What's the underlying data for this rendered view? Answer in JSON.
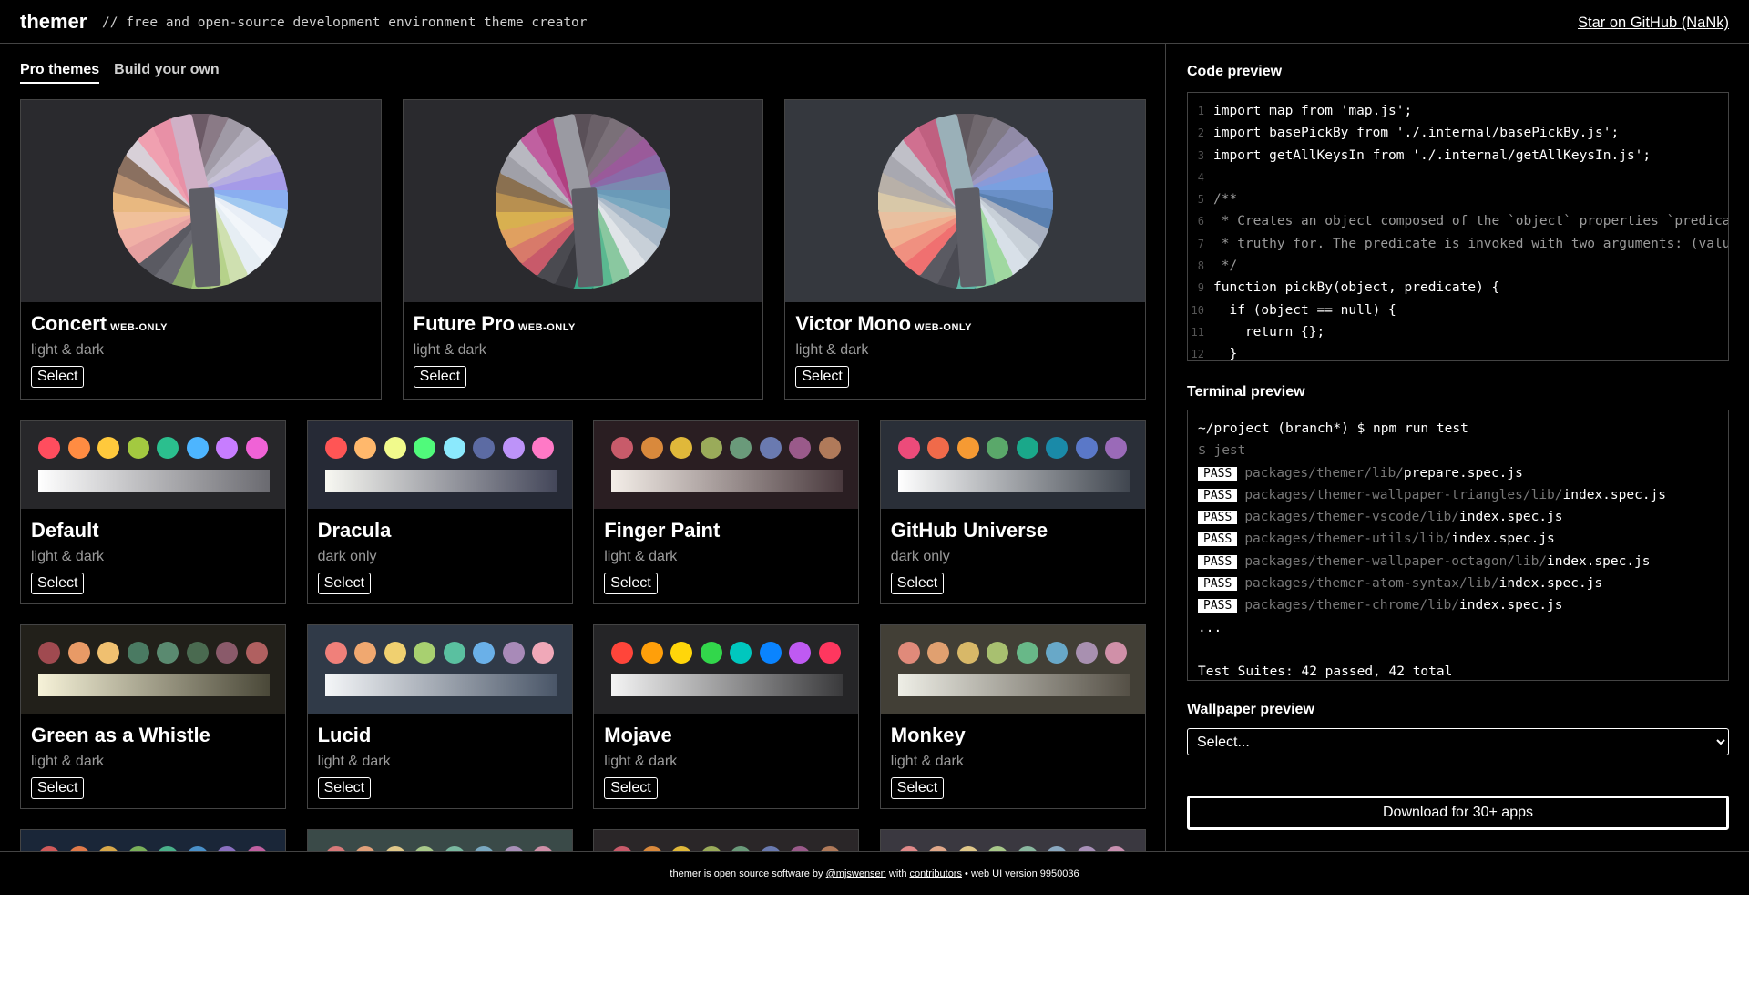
{
  "header": {
    "brand": "themer",
    "tagline": "// free and open-source development environment theme creator",
    "github_link": "Star on GitHub (NaNk)"
  },
  "tabs": [
    {
      "label": "Pro themes",
      "active": true
    },
    {
      "label": "Build your own",
      "active": false
    }
  ],
  "pro_themes": [
    {
      "name": "Concert",
      "badge": "WEB-ONLY",
      "modes": "light & dark",
      "select": "Select",
      "bg": "#2a2a2e",
      "fan": [
        "#6c5a66",
        "#8a7a86",
        "#a09aa6",
        "#b8b4c2",
        "#c7c2d6",
        "#b6aee0",
        "#a59ae8",
        "#8aaef0",
        "#a0c8f0",
        "#e8eef6",
        "#f2f6fa",
        "#e6eef4",
        "#cfe0b0",
        "#b6d28a",
        "#a0c878",
        "#8aa86a",
        "#6a6a72",
        "#5a5a62",
        "#e6a0a0",
        "#f0b0a6",
        "#f0c09a",
        "#e8b880",
        "#b89070",
        "#8a7060",
        "#d8d0d8",
        "#f0a0b0",
        "#e890a6",
        "#d0b0c6"
      ]
    },
    {
      "name": "Future Pro",
      "badge": "WEB-ONLY",
      "modes": "light & dark",
      "select": "Select",
      "bg": "#2a2a2e",
      "fan": [
        "#5a5058",
        "#6a6068",
        "#7a7078",
        "#8a6a8a",
        "#9a5a9a",
        "#8a6aa8",
        "#7a8ab0",
        "#6a9ab8",
        "#7aa8c0",
        "#a8b8c8",
        "#c8d0d8",
        "#e0e4e8",
        "#8ac8a0",
        "#5ab890",
        "#3aa888",
        "#3a3a40",
        "#4a4a50",
        "#c85a6a",
        "#d87a6a",
        "#e0a060",
        "#d8b050",
        "#b89050",
        "#8a7050",
        "#a0a0a8",
        "#b8b8c0",
        "#c060a0",
        "#b04080",
        "#9a9aa2"
      ]
    },
    {
      "name": "Victor Mono",
      "badge": "WEB-ONLY",
      "modes": "light & dark",
      "select": "Select",
      "bg": "#35383e",
      "fan": [
        "#60585e",
        "#70686e",
        "#807a86",
        "#908aa6",
        "#a09ac0",
        "#8a9ad8",
        "#7aa0e0",
        "#6a90c8",
        "#5a80b0",
        "#a8b0c0",
        "#c8d0d8",
        "#d8e0e8",
        "#a0d8a0",
        "#80c8a0",
        "#60b8a8",
        "#4a4a52",
        "#5a5a62",
        "#f07070",
        "#f09080",
        "#f0b090",
        "#e8c0a0",
        "#d8c8a8",
        "#b8b0a8",
        "#a8a8b0",
        "#c0c0c8",
        "#d07090",
        "#c06080",
        "#9ab0b8"
      ]
    }
  ],
  "themes": [
    {
      "name": "Default",
      "modes": "light & dark",
      "select": "Select",
      "bg": "#27272a",
      "dots": [
        "#ff4d5e",
        "#ff8c42",
        "#ffc93c",
        "#a3c940",
        "#2bbf8e",
        "#4db5ff",
        "#c77dff",
        "#f062d6"
      ],
      "grad": [
        "#ffffff",
        "#6a6a70"
      ]
    },
    {
      "name": "Dracula",
      "modes": "dark only",
      "select": "Select",
      "bg": "#262a36",
      "dots": [
        "#ff5555",
        "#ffb86c",
        "#f1fa8c",
        "#50fa7b",
        "#8be9fd",
        "#5c6ba3",
        "#bd93f9",
        "#ff79c6"
      ],
      "grad": [
        "#f8f8f2",
        "#44475a"
      ]
    },
    {
      "name": "Finger Paint",
      "modes": "light & dark",
      "select": "Select",
      "bg": "#2a1e22",
      "dots": [
        "#c85b6a",
        "#d9893c",
        "#e0b83a",
        "#9aab5a",
        "#6a9a7a",
        "#6a7ab0",
        "#9a5a8a",
        "#b07a5a"
      ],
      "grad": [
        "#f4eee8",
        "#4a3a3e"
      ]
    },
    {
      "name": "GitHub Universe",
      "modes": "dark only",
      "select": "Select",
      "bg": "#2a2f38",
      "dots": [
        "#ec4b7a",
        "#f06a4a",
        "#f59a33",
        "#5aa86a",
        "#1aa88a",
        "#1a8aa8",
        "#5a78c8",
        "#9a6ab8"
      ],
      "grad": [
        "#ffffff",
        "#40464f"
      ]
    },
    {
      "name": "Green as a Whistle",
      "modes": "light & dark",
      "select": "Select",
      "bg": "#22201a",
      "dots": [
        "#a04a50",
        "#e89a66",
        "#f0c070",
        "#4a7a62",
        "#5a8a70",
        "#4a6a50",
        "#8a5a6a",
        "#b06060"
      ],
      "grad": [
        "#f6f2d8",
        "#4a4838"
      ]
    },
    {
      "name": "Lucid",
      "modes": "light & dark",
      "select": "Select",
      "bg": "#303a48",
      "dots": [
        "#f0807a",
        "#f0a870",
        "#f0d070",
        "#a8d070",
        "#5ac0a0",
        "#6ab0e8",
        "#a88ab8",
        "#f0a8b8"
      ],
      "grad": [
        "#f4f6f8",
        "#4a5668"
      ]
    },
    {
      "name": "Mojave",
      "modes": "light & dark",
      "select": "Select",
      "bg": "#252527",
      "dots": [
        "#ff453a",
        "#ff9f0a",
        "#ffd60a",
        "#32d74b",
        "#00c7be",
        "#0a84ff",
        "#bf5af2",
        "#ff375f"
      ],
      "grad": [
        "#f4f4f4",
        "#3a3a3c"
      ]
    },
    {
      "name": "Monkey",
      "modes": "light & dark",
      "select": "Select",
      "bg": "#423f36",
      "dots": [
        "#e08a7a",
        "#e0a070",
        "#d8b868",
        "#a8c070",
        "#68b888",
        "#68a8c8",
        "#a890b0",
        "#d090a8"
      ],
      "grad": [
        "#eeeee6",
        "#555046"
      ]
    },
    {
      "name": "",
      "modes": "",
      "select": "",
      "bg": "#1a2638",
      "dots": [
        "#d05a5a",
        "#e07a4a",
        "#d8a84a",
        "#7ab05a",
        "#4ab08a",
        "#4a90c8",
        "#8a70c0",
        "#c060a0"
      ],
      "grad": [
        "#ffffff",
        "#444"
      ]
    },
    {
      "name": "",
      "modes": "",
      "select": "",
      "bg": "#3a4a48",
      "dots": [
        "#d87a7a",
        "#e0a07a",
        "#e0c88a",
        "#a8c88a",
        "#7ab8a0",
        "#7aa8c0",
        "#a890b8",
        "#d090a8"
      ],
      "grad": [
        "#ffffff",
        "#444"
      ]
    },
    {
      "name": "",
      "modes": "",
      "select": "",
      "bg": "#2a2628",
      "dots": [
        "#c85a6a",
        "#d9893c",
        "#e0b83a",
        "#9aab5a",
        "#6a9a7a",
        "#6a7ab0",
        "#9a5a8a",
        "#b07a5a"
      ],
      "grad": [
        "#ffffff",
        "#444"
      ]
    },
    {
      "name": "",
      "modes": "",
      "select": "",
      "bg": "#3a3840",
      "dots": [
        "#e08a8a",
        "#e0a88a",
        "#e0c88a",
        "#a8c88a",
        "#8ab8a0",
        "#8aa8c0",
        "#a890b8",
        "#c890b0"
      ],
      "grad": [
        "#ffffff",
        "#444"
      ]
    }
  ],
  "code_preview": {
    "title": "Code preview",
    "lines": [
      {
        "n": "1",
        "text": "import map from 'map.js';"
      },
      {
        "n": "2",
        "text": "import basePickBy from './.internal/basePickBy.js';"
      },
      {
        "n": "3",
        "text": "import getAllKeysIn from './.internal/getAllKeysIn.js';"
      },
      {
        "n": "4",
        "text": ""
      },
      {
        "n": "5",
        "text": "/**",
        "comment": true
      },
      {
        "n": "6",
        "text": " * Creates an object composed of the `object` properties `predicate` returns",
        "comment": true
      },
      {
        "n": "7",
        "text": " * truthy for. The predicate is invoked with two arguments: (value, key).",
        "comment": true
      },
      {
        "n": "8",
        "text": " */",
        "comment": true
      },
      {
        "n": "9",
        "text": "function pickBy(object, predicate) {"
      },
      {
        "n": "10",
        "text": "  if (object == null) {"
      },
      {
        "n": "11",
        "text": "    return {};"
      },
      {
        "n": "12",
        "text": "  }"
      }
    ]
  },
  "terminal_preview": {
    "title": "Terminal preview",
    "prompt": "~/project (branch*) $ npm run test",
    "cmd": "$ jest",
    "pass_label": "PASS",
    "results": [
      {
        "dir": "packages/themer/lib/",
        "file": "prepare.spec.js"
      },
      {
        "dir": "packages/themer-wallpaper-triangles/lib/",
        "file": "index.spec.js"
      },
      {
        "dir": "packages/themer-vscode/lib/",
        "file": "index.spec.js"
      },
      {
        "dir": "packages/themer-utils/lib/",
        "file": "index.spec.js"
      },
      {
        "dir": "packages/themer-wallpaper-octagon/lib/",
        "file": "index.spec.js"
      },
      {
        "dir": "packages/themer-atom-syntax/lib/",
        "file": "index.spec.js"
      },
      {
        "dir": "packages/themer-chrome/lib/",
        "file": "index.spec.js"
      }
    ],
    "ellipsis": "...",
    "summary": "Test Suites: 42 passed, 42 total"
  },
  "wallpaper_preview": {
    "title": "Wallpaper preview",
    "selected": "Select..."
  },
  "download_label": "Download for 30+ apps",
  "footer": {
    "prefix": "themer is open source software by ",
    "author": "@mjswensen",
    "middle": " with ",
    "contributors": "contributors",
    "suffix": " • web UI version 9950036"
  }
}
